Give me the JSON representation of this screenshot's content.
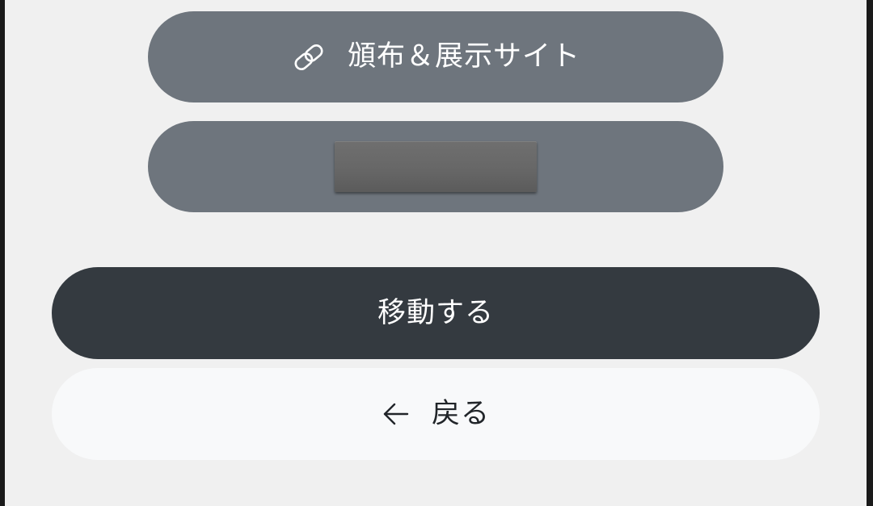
{
  "buttons": {
    "distribution": {
      "label": "頒布＆展示サイト",
      "icon": "link-icon"
    },
    "masked": {
      "label": ""
    },
    "move": {
      "label": "移動する"
    },
    "back": {
      "label": "戻る",
      "icon": "arrow-left-icon"
    }
  },
  "colors": {
    "background": "#f0f0f0",
    "secondary_button": "#6e757d",
    "primary_button": "#343a40",
    "light_button": "#f8f9fa"
  }
}
